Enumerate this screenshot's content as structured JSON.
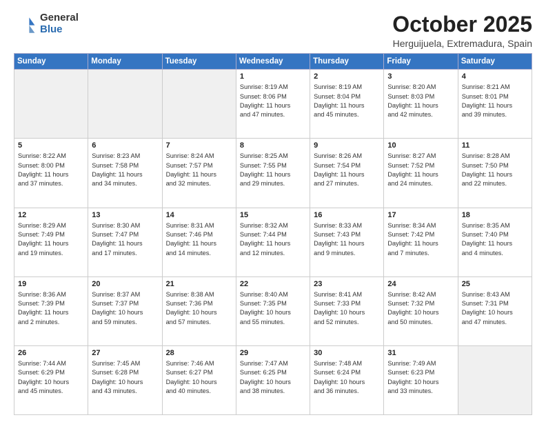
{
  "logo": {
    "general": "General",
    "blue": "Blue"
  },
  "header": {
    "month": "October 2025",
    "location": "Herguijuela, Extremadura, Spain"
  },
  "weekdays": [
    "Sunday",
    "Monday",
    "Tuesday",
    "Wednesday",
    "Thursday",
    "Friday",
    "Saturday"
  ],
  "weeks": [
    [
      {
        "day": "",
        "info": ""
      },
      {
        "day": "",
        "info": ""
      },
      {
        "day": "",
        "info": ""
      },
      {
        "day": "1",
        "info": "Sunrise: 8:19 AM\nSunset: 8:06 PM\nDaylight: 11 hours\nand 47 minutes."
      },
      {
        "day": "2",
        "info": "Sunrise: 8:19 AM\nSunset: 8:04 PM\nDaylight: 11 hours\nand 45 minutes."
      },
      {
        "day": "3",
        "info": "Sunrise: 8:20 AM\nSunset: 8:03 PM\nDaylight: 11 hours\nand 42 minutes."
      },
      {
        "day": "4",
        "info": "Sunrise: 8:21 AM\nSunset: 8:01 PM\nDaylight: 11 hours\nand 39 minutes."
      }
    ],
    [
      {
        "day": "5",
        "info": "Sunrise: 8:22 AM\nSunset: 8:00 PM\nDaylight: 11 hours\nand 37 minutes."
      },
      {
        "day": "6",
        "info": "Sunrise: 8:23 AM\nSunset: 7:58 PM\nDaylight: 11 hours\nand 34 minutes."
      },
      {
        "day": "7",
        "info": "Sunrise: 8:24 AM\nSunset: 7:57 PM\nDaylight: 11 hours\nand 32 minutes."
      },
      {
        "day": "8",
        "info": "Sunrise: 8:25 AM\nSunset: 7:55 PM\nDaylight: 11 hours\nand 29 minutes."
      },
      {
        "day": "9",
        "info": "Sunrise: 8:26 AM\nSunset: 7:54 PM\nDaylight: 11 hours\nand 27 minutes."
      },
      {
        "day": "10",
        "info": "Sunrise: 8:27 AM\nSunset: 7:52 PM\nDaylight: 11 hours\nand 24 minutes."
      },
      {
        "day": "11",
        "info": "Sunrise: 8:28 AM\nSunset: 7:50 PM\nDaylight: 11 hours\nand 22 minutes."
      }
    ],
    [
      {
        "day": "12",
        "info": "Sunrise: 8:29 AM\nSunset: 7:49 PM\nDaylight: 11 hours\nand 19 minutes."
      },
      {
        "day": "13",
        "info": "Sunrise: 8:30 AM\nSunset: 7:47 PM\nDaylight: 11 hours\nand 17 minutes."
      },
      {
        "day": "14",
        "info": "Sunrise: 8:31 AM\nSunset: 7:46 PM\nDaylight: 11 hours\nand 14 minutes."
      },
      {
        "day": "15",
        "info": "Sunrise: 8:32 AM\nSunset: 7:44 PM\nDaylight: 11 hours\nand 12 minutes."
      },
      {
        "day": "16",
        "info": "Sunrise: 8:33 AM\nSunset: 7:43 PM\nDaylight: 11 hours\nand 9 minutes."
      },
      {
        "day": "17",
        "info": "Sunrise: 8:34 AM\nSunset: 7:42 PM\nDaylight: 11 hours\nand 7 minutes."
      },
      {
        "day": "18",
        "info": "Sunrise: 8:35 AM\nSunset: 7:40 PM\nDaylight: 11 hours\nand 4 minutes."
      }
    ],
    [
      {
        "day": "19",
        "info": "Sunrise: 8:36 AM\nSunset: 7:39 PM\nDaylight: 11 hours\nand 2 minutes."
      },
      {
        "day": "20",
        "info": "Sunrise: 8:37 AM\nSunset: 7:37 PM\nDaylight: 10 hours\nand 59 minutes."
      },
      {
        "day": "21",
        "info": "Sunrise: 8:38 AM\nSunset: 7:36 PM\nDaylight: 10 hours\nand 57 minutes."
      },
      {
        "day": "22",
        "info": "Sunrise: 8:40 AM\nSunset: 7:35 PM\nDaylight: 10 hours\nand 55 minutes."
      },
      {
        "day": "23",
        "info": "Sunrise: 8:41 AM\nSunset: 7:33 PM\nDaylight: 10 hours\nand 52 minutes."
      },
      {
        "day": "24",
        "info": "Sunrise: 8:42 AM\nSunset: 7:32 PM\nDaylight: 10 hours\nand 50 minutes."
      },
      {
        "day": "25",
        "info": "Sunrise: 8:43 AM\nSunset: 7:31 PM\nDaylight: 10 hours\nand 47 minutes."
      }
    ],
    [
      {
        "day": "26",
        "info": "Sunrise: 7:44 AM\nSunset: 6:29 PM\nDaylight: 10 hours\nand 45 minutes."
      },
      {
        "day": "27",
        "info": "Sunrise: 7:45 AM\nSunset: 6:28 PM\nDaylight: 10 hours\nand 43 minutes."
      },
      {
        "day": "28",
        "info": "Sunrise: 7:46 AM\nSunset: 6:27 PM\nDaylight: 10 hours\nand 40 minutes."
      },
      {
        "day": "29",
        "info": "Sunrise: 7:47 AM\nSunset: 6:25 PM\nDaylight: 10 hours\nand 38 minutes."
      },
      {
        "day": "30",
        "info": "Sunrise: 7:48 AM\nSunset: 6:24 PM\nDaylight: 10 hours\nand 36 minutes."
      },
      {
        "day": "31",
        "info": "Sunrise: 7:49 AM\nSunset: 6:23 PM\nDaylight: 10 hours\nand 33 minutes."
      },
      {
        "day": "",
        "info": ""
      }
    ]
  ]
}
